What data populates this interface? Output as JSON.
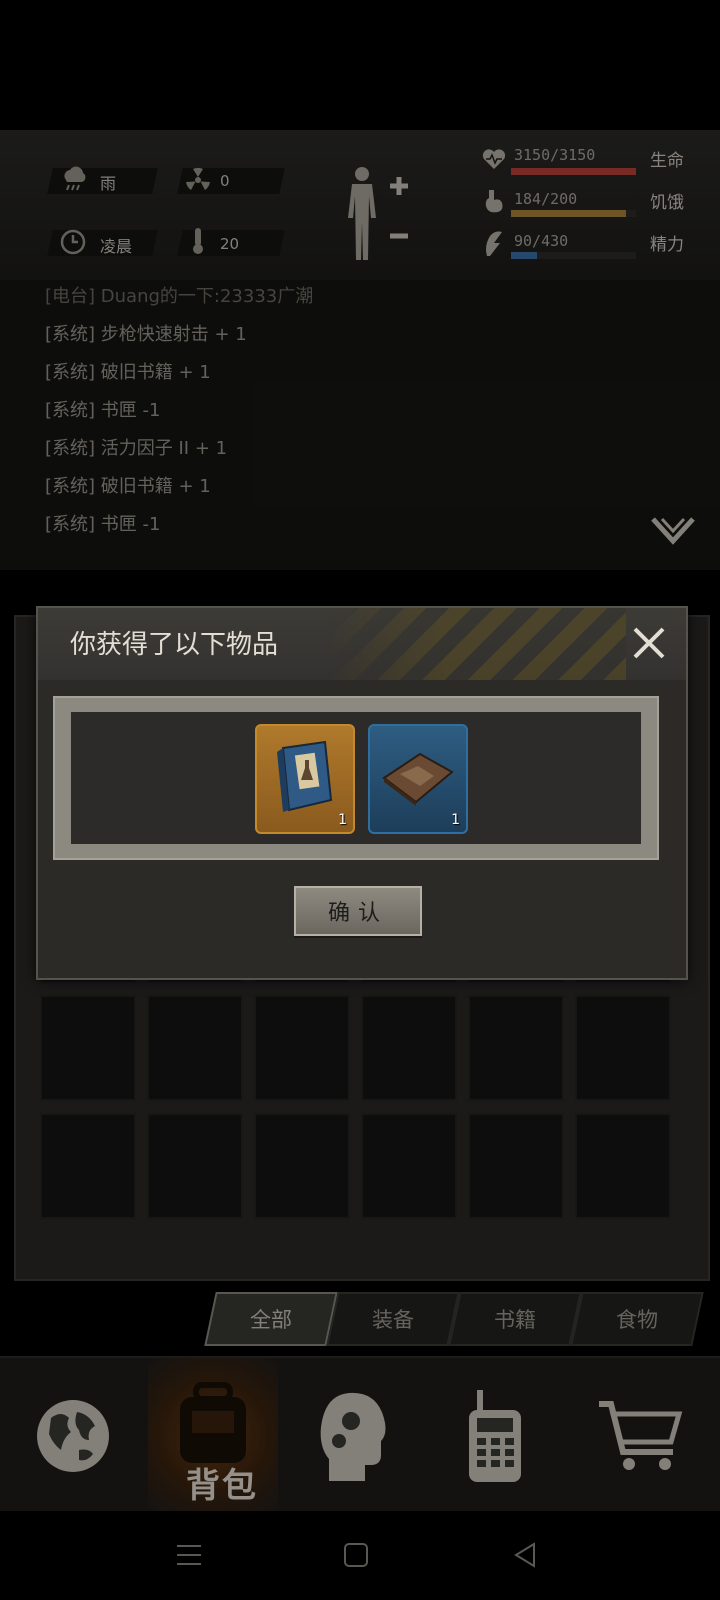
{
  "status": {
    "weather": "雨",
    "radiation": "0",
    "time_of_day": "凌晨",
    "temperature": "20",
    "health": {
      "value": "3150/3150",
      "label": "生命",
      "fraction": 1.0,
      "color": "#b8423a"
    },
    "hunger": {
      "value": "184/200",
      "label": "饥饿",
      "fraction": 0.92,
      "color": "#a8833a"
    },
    "energy": {
      "value": "90/430",
      "label": "精力",
      "fraction": 0.21,
      "color": "#3d6fa8"
    },
    "icons": [
      "rain-icon",
      "radiation-icon",
      "clock-icon",
      "thermometer-icon",
      "body-figure-icon",
      "heart-icon",
      "stomach-icon",
      "energy-icon"
    ]
  },
  "log": {
    "lines": [
      "[电台] Duang的一下:23333广潮",
      "[系统] 步枪快速射击 + 1",
      "[系统] 破旧书籍 + 1",
      "[系统] 书匣 -1",
      "[系统] 活力因子 II + 1",
      "[系统] 破旧书籍 + 1",
      "[系统] 书匣 -1"
    ]
  },
  "dialog": {
    "title": "你获得了以下物品",
    "items": [
      {
        "name": "blue-book-item",
        "count": "1",
        "rarity_color": "#c48a2a"
      },
      {
        "name": "old-map-book-item",
        "count": "1",
        "rarity_color": "#2d6fa0"
      }
    ],
    "confirm_label": "确认"
  },
  "tabs": [
    "全部",
    "装备",
    "书籍",
    "食物"
  ],
  "active_tab": "全部",
  "bottom_nav": {
    "bag_label": "背包",
    "icons": [
      "globe-icon",
      "backpack-icon",
      "head-gears-icon",
      "radio-icon",
      "cart-icon"
    ]
  }
}
